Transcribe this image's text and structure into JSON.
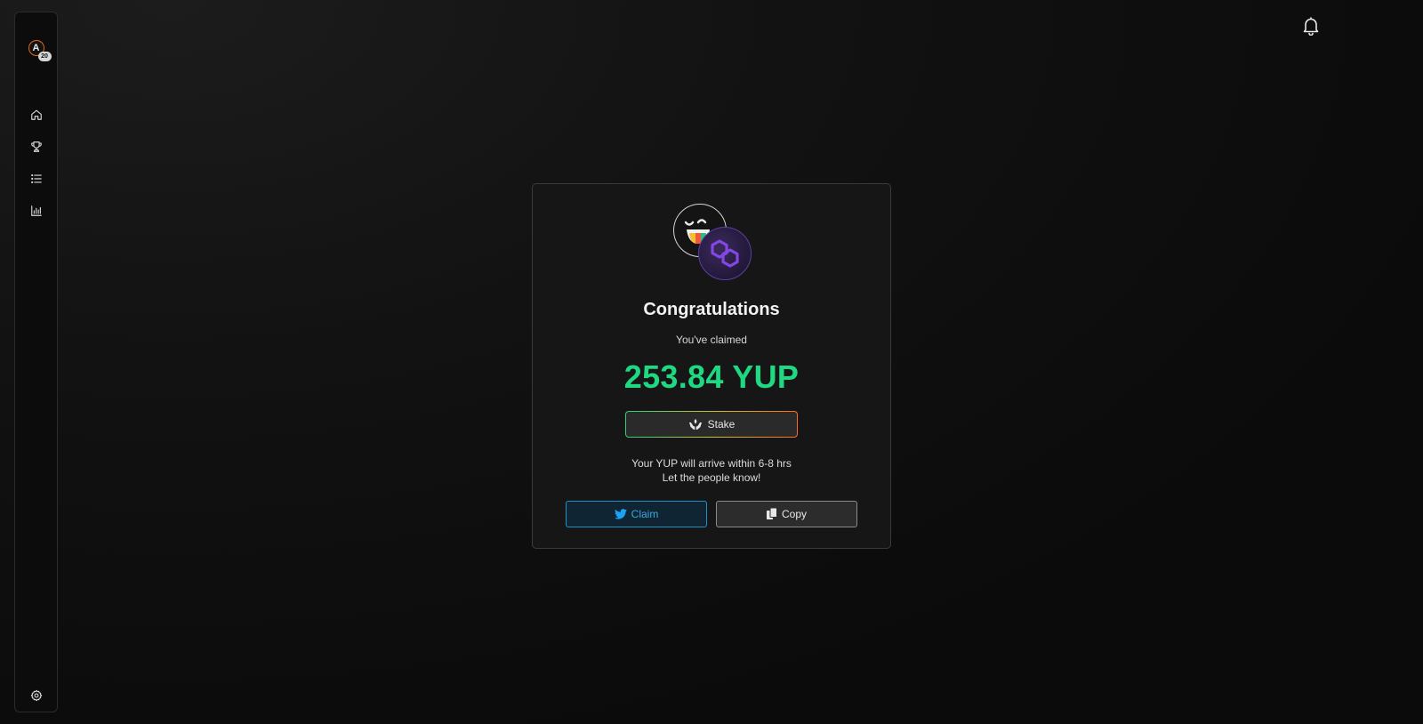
{
  "sidebar": {
    "avatar_initial": "A",
    "avatar_badge": "20",
    "items": [
      {
        "icon": "home-icon"
      },
      {
        "icon": "trophy-icon"
      },
      {
        "icon": "list-icon"
      },
      {
        "icon": "bar-chart-icon"
      }
    ],
    "settings_icon": "gear-icon"
  },
  "header": {
    "notification_icon": "bell-icon"
  },
  "modal": {
    "title": "Congratulations",
    "subtitle": "You've claimed",
    "amount": "253.84 YUP",
    "stake_label": "Stake",
    "note_line1": "Your YUP will arrive within 6-8 hrs",
    "note_line2": "Let the people know!",
    "claim_label": "Claim",
    "copy_label": "Copy"
  },
  "colors": {
    "amount": "#1fd882",
    "claim_accent": "#1d90c8",
    "polygon_purple": "#8247e5",
    "avatar_ring": "#e06a1c"
  }
}
